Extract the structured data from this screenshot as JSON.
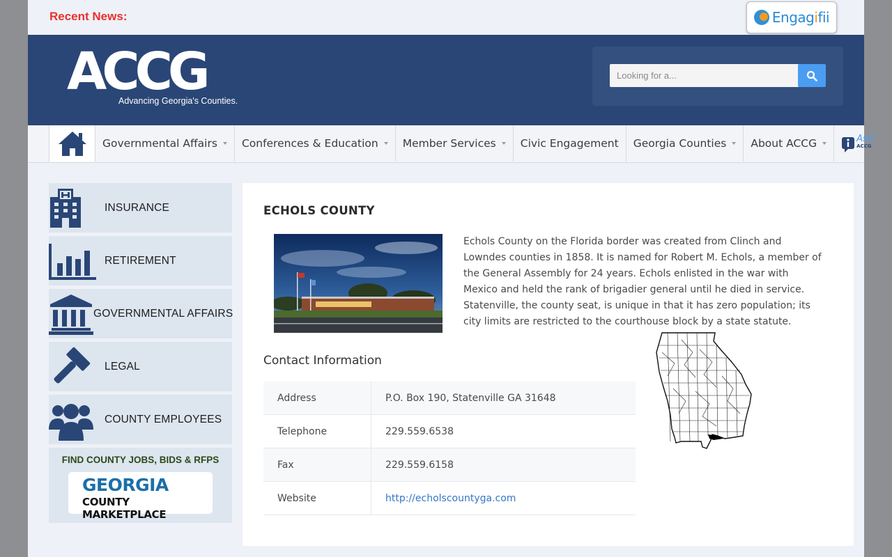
{
  "topbar": {
    "recent_news": "Recent News:",
    "engage_logo_prefix": "Engag",
    "engage_logo_mid": "i",
    "engage_logo_suffix": "fii"
  },
  "header": {
    "logo_text": "ACCG",
    "tagline": "Advancing Georgia's Counties.",
    "search_placeholder": "Looking for a..."
  },
  "nav": {
    "items": [
      {
        "label": "Governmental Affairs",
        "dropdown": true
      },
      {
        "label": "Conferences & Education",
        "dropdown": true
      },
      {
        "label": "Member Services",
        "dropdown": true
      },
      {
        "label": "Civic Engagement",
        "dropdown": false
      },
      {
        "label": "Georgia Counties",
        "dropdown": true
      },
      {
        "label": "About ACCG",
        "dropdown": true
      }
    ],
    "ask_label": "Ask!",
    "ask_sub": "ACCG"
  },
  "sidebar": {
    "items": [
      {
        "label": "INSURANCE",
        "icon": "hospital-icon"
      },
      {
        "label": "RETIREMENT",
        "icon": "bar-chart-icon"
      },
      {
        "label": "GOVERNMENTAL AFFAIRS",
        "icon": "government-building-icon"
      },
      {
        "label": "LEGAL",
        "icon": "gavel-icon"
      },
      {
        "label": "COUNTY EMPLOYEES",
        "icon": "people-icon"
      }
    ],
    "marketplace": {
      "title": "FIND COUNTY JOBS, BIDS & RFPS",
      "logo_line1": "GEORGIA",
      "logo_line2": "COUNTY MARKETPLACE"
    }
  },
  "main": {
    "title": "ECHOLS COUNTY",
    "description": "Echols County on the Florida border was created from Clinch and Lowndes counties in 1858. It is named for Robert M. Echols, a member of the General Assembly for 24 years. Echols enlisted in the war with Mexico and held the rank of brigadier general until he died in service. Statenville, the county seat, is unique in that it has zero population; its city limits are restricted to the courthouse block by a state statute.",
    "contact_heading": "Contact Information",
    "contact": {
      "address_label": "Address",
      "address": "P.O. Box 190, Statenville GA 31648",
      "phone_label": "Telephone",
      "phone": "229.559.6538",
      "fax_label": "Fax",
      "fax": "229.559.6158",
      "website_label": "Website",
      "website": "http://echolscountyga.com"
    }
  },
  "colors": {
    "header_blue": "#2a4676",
    "accent_red": "#e8302e",
    "link_blue": "#3677c4",
    "search_button": "#4a9df0"
  }
}
